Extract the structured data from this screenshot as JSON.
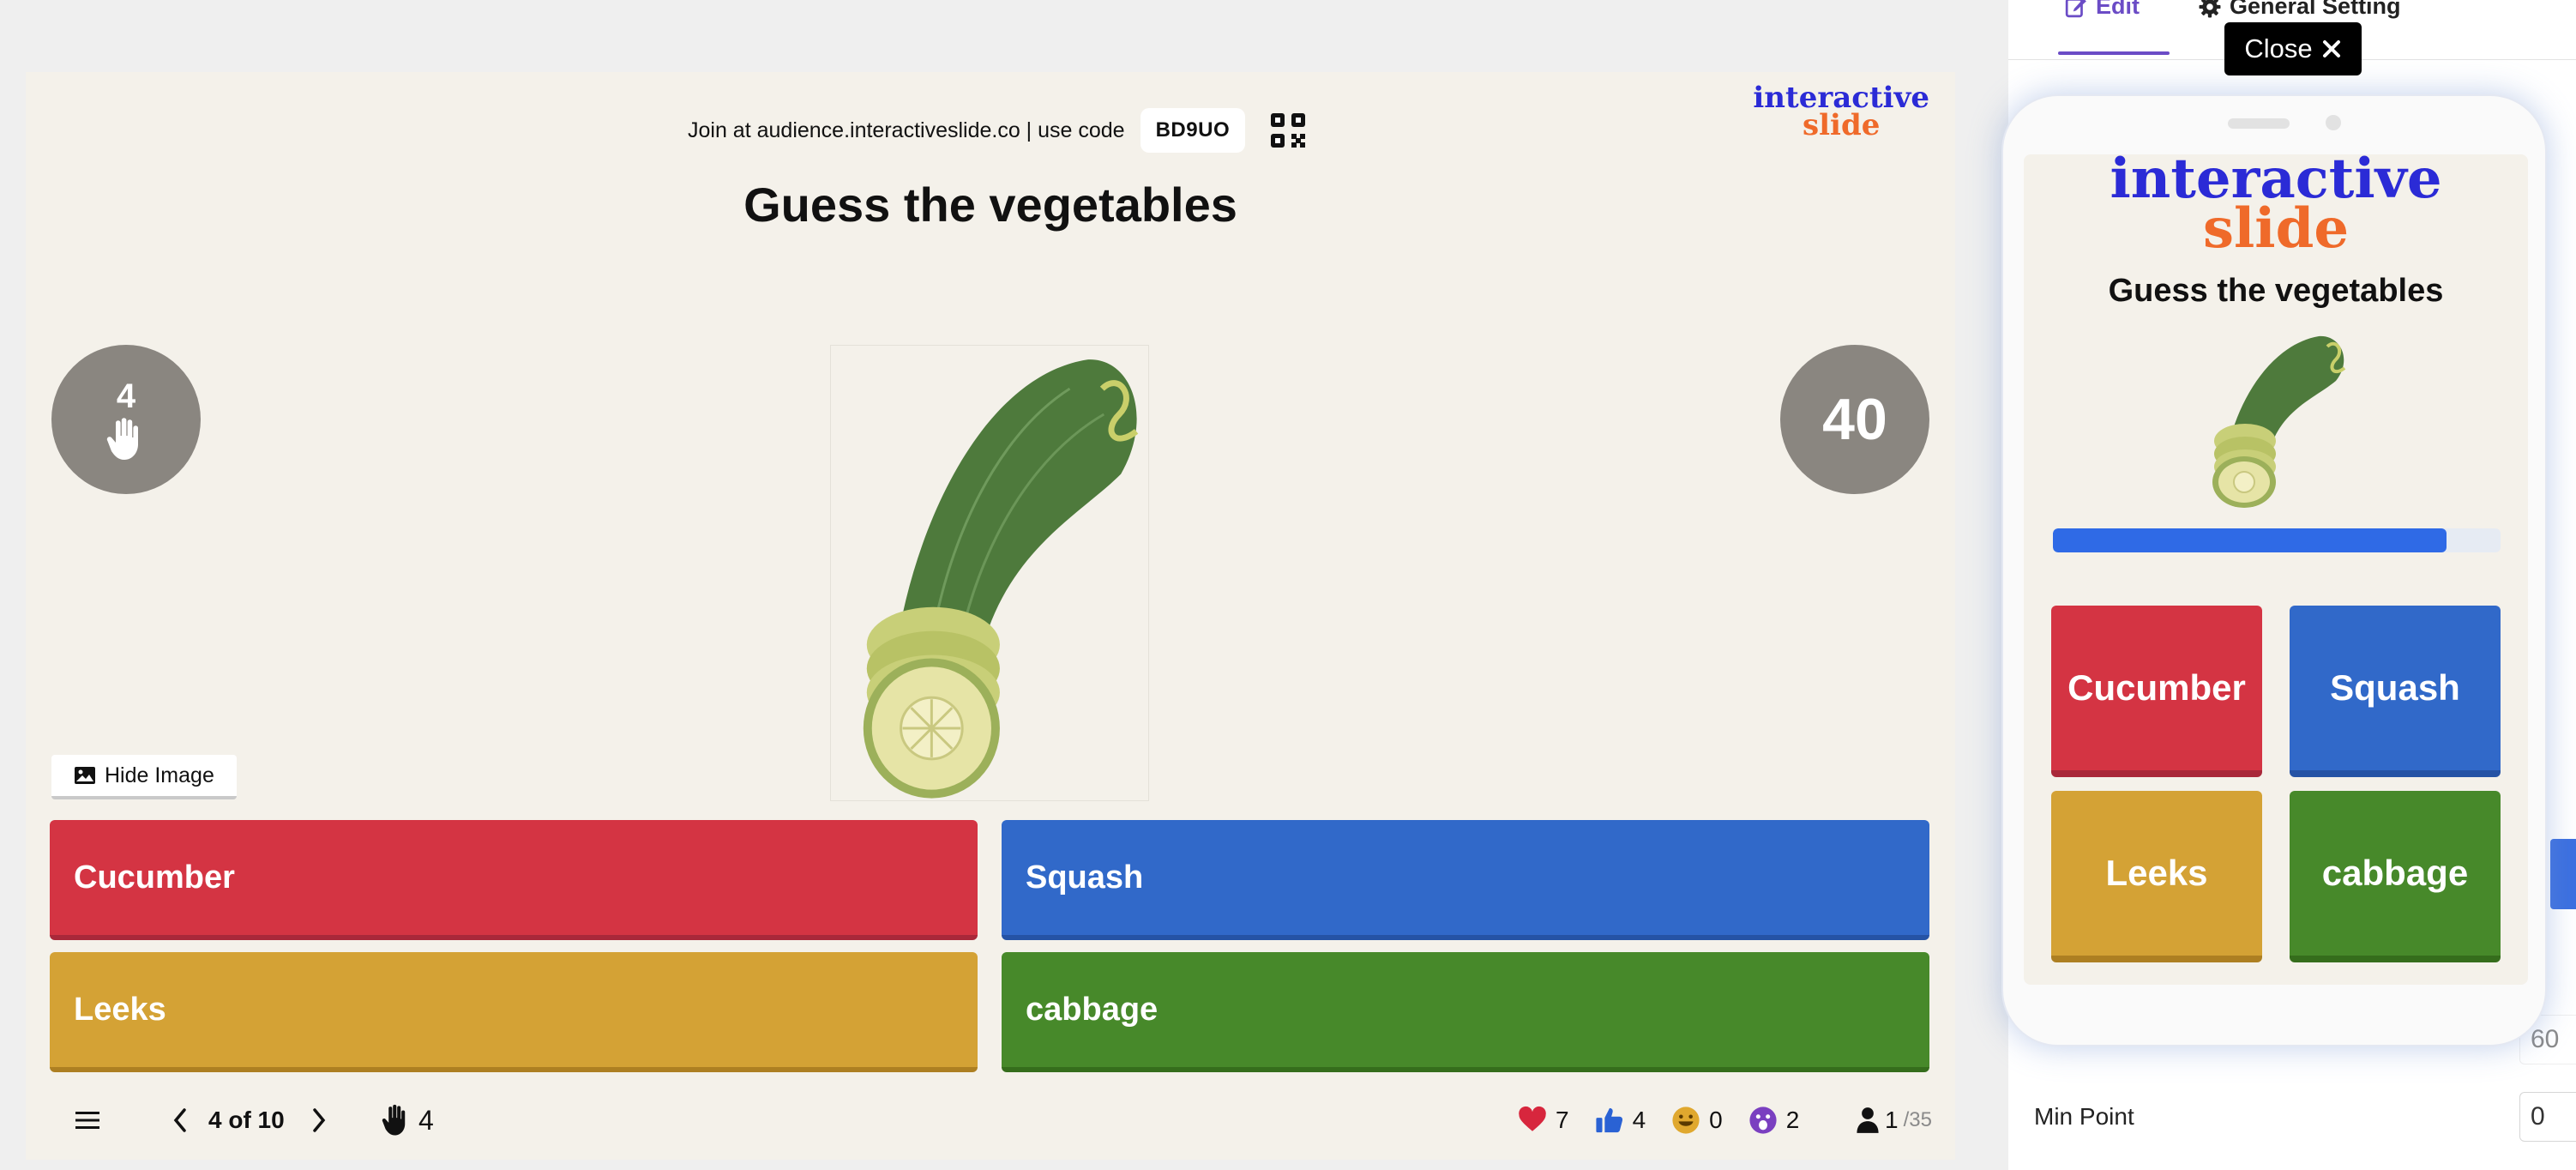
{
  "stage": {
    "join_text": "Join at audience.interactiveslide.co | use code",
    "code": "BD9UO",
    "brand_line1": "interactive",
    "brand_line2": "slide",
    "title": "Guess the vegetables",
    "raised_hands": "4",
    "timer": "40",
    "hide_image_label": "Hide Image",
    "answers": [
      {
        "label": "Cucumber",
        "color": "#d43443"
      },
      {
        "label": "Squash",
        "color": "#3169c9"
      },
      {
        "label": "Leeks",
        "color": "#d4a235"
      },
      {
        "label": "cabbage",
        "color": "#47892a"
      }
    ],
    "image_icon": "cucumber-illustration"
  },
  "bottom_bar": {
    "slide_counter": "4 of 10",
    "raise_count": "4",
    "reactions": [
      {
        "icon": "heart-icon",
        "count": "7"
      },
      {
        "icon": "thumbs-up-icon",
        "count": "4"
      },
      {
        "icon": "laugh-icon",
        "count": "0"
      },
      {
        "icon": "surprised-icon",
        "count": "2"
      }
    ],
    "participants_online": "1",
    "participants_total": "/35"
  },
  "panel": {
    "tab_edit": "Edit",
    "tab_general": "General Setting",
    "score_value": "60",
    "min_point_label": "Min Point",
    "min_point_value": "0"
  },
  "close_label": "Close",
  "phone": {
    "brand_line1": "interactive",
    "brand_line2": "slide",
    "title": "Guess the vegetables",
    "progress": 0.88,
    "answers": [
      "Cucumber",
      "Squash",
      "Leeks",
      "cabbage"
    ]
  },
  "colors": {
    "accent": "#6b4cc6",
    "stage_bg": "#f4f1ea",
    "brand_blue": "#2b2bd6",
    "brand_orange": "#ef6a2a",
    "progress": "#2f6ae6"
  }
}
